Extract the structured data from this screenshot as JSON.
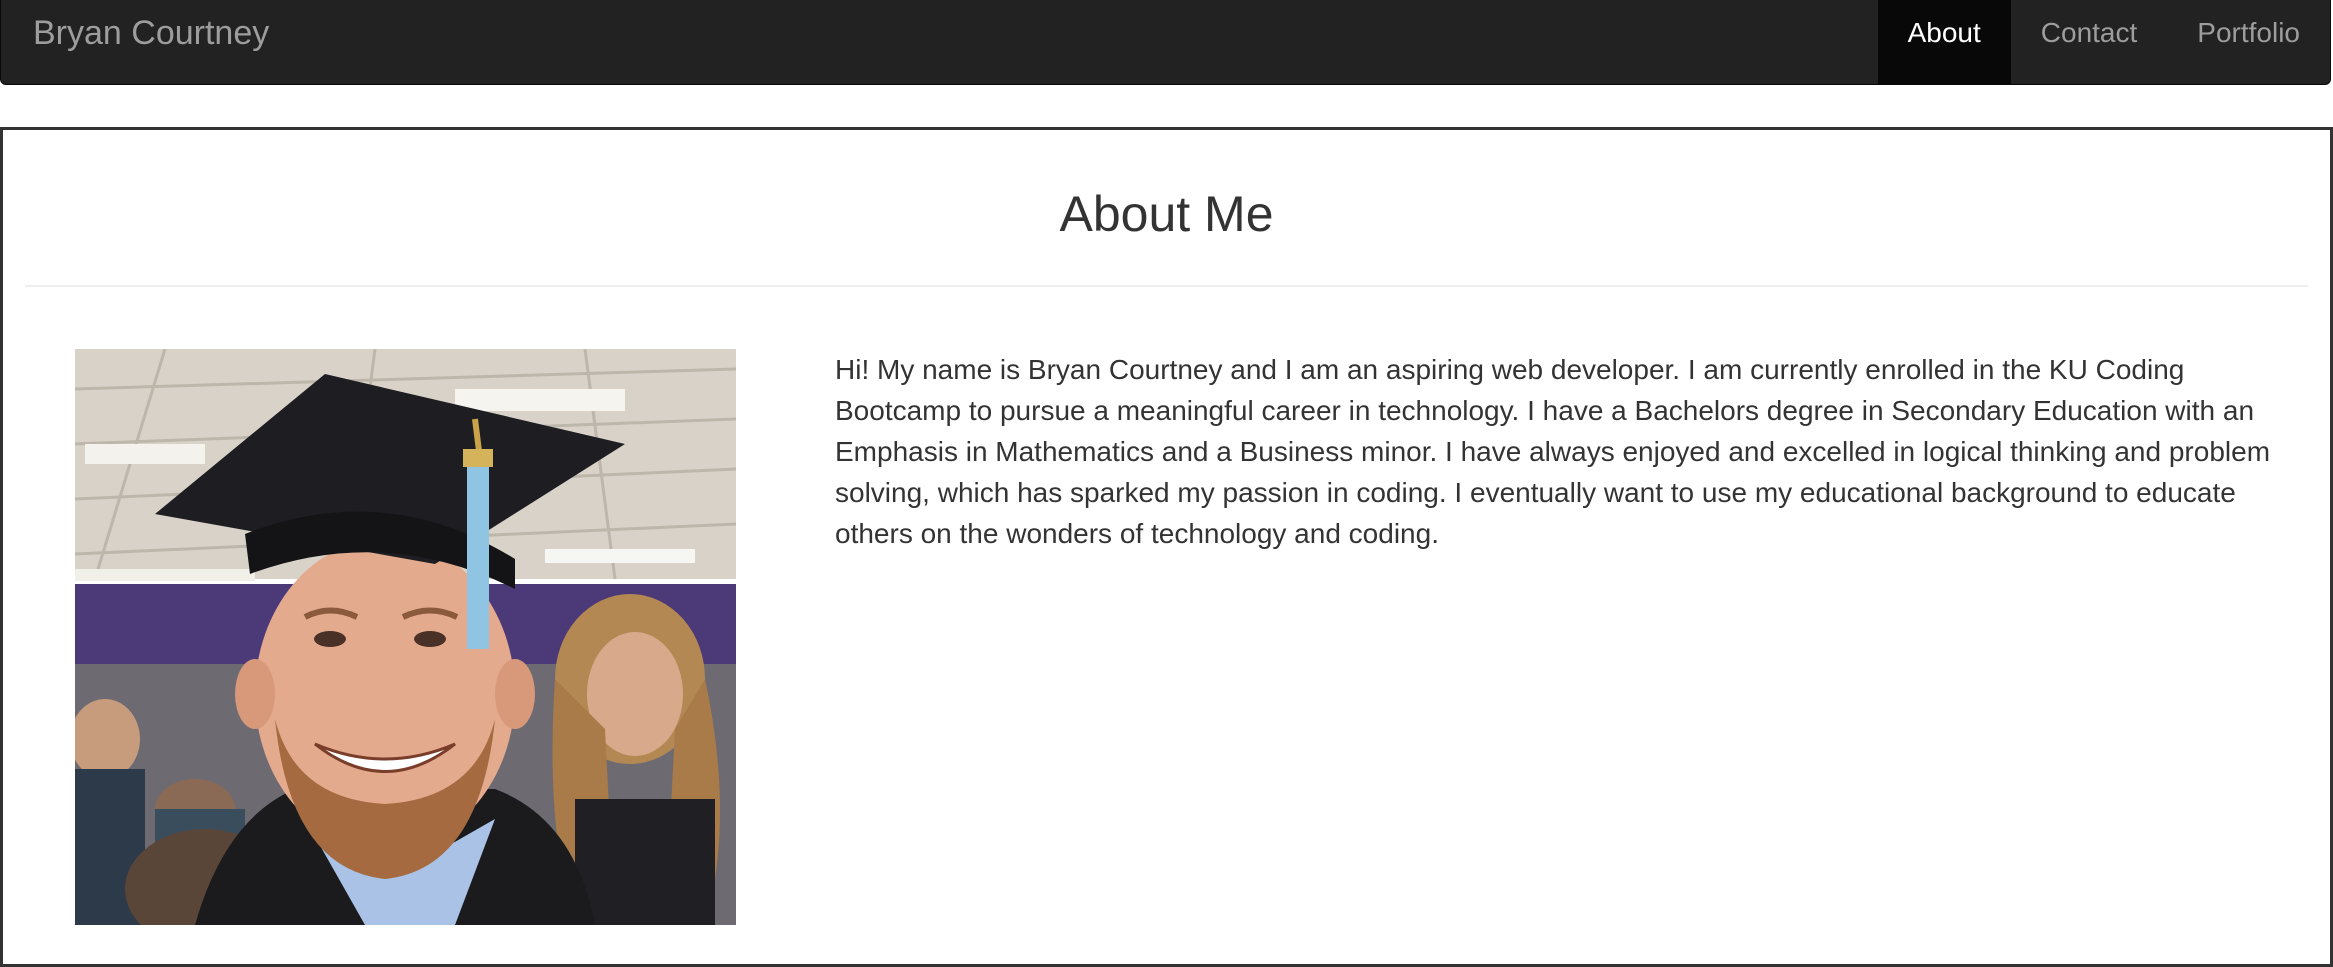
{
  "navbar": {
    "brand": "Bryan Courtney",
    "items": [
      {
        "label": "About",
        "active": true
      },
      {
        "label": "Contact",
        "active": false
      },
      {
        "label": "Portfolio",
        "active": false
      }
    ]
  },
  "about": {
    "title": "About Me",
    "bio": "Hi! My name is Bryan Courtney and I am an aspiring web developer. I am currently enrolled in the KU Coding Bootcamp to pursue a meaningful career in technology. I have a Bachelors degree in Secondary Education with an Emphasis in Mathematics and a Business minor. I have always enjoyed and excelled in logical thinking and problem solving, which has sparked my passion in coding. I eventually want to use my educational background to educate others on the wonders of technology and coding."
  },
  "colors": {
    "navbar_bg": "#222222",
    "navbar_active_bg": "#080808",
    "nav_text": "#9d9d9d",
    "nav_active_text": "#ffffff",
    "panel_border": "#333333",
    "body_text": "#333333"
  }
}
